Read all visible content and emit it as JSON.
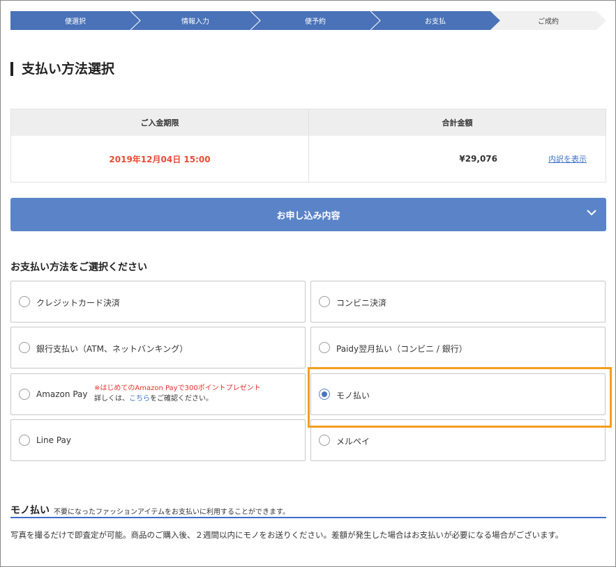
{
  "stepper": {
    "steps": [
      {
        "label": "便選択",
        "state": "done"
      },
      {
        "label": "情報入力",
        "state": "done"
      },
      {
        "label": "便予約",
        "state": "done"
      },
      {
        "label": "お支払",
        "state": "current"
      },
      {
        "label": "ご成約",
        "state": "todo"
      }
    ],
    "active_color": "#4a72b8",
    "todo_color": "#f0f0f0"
  },
  "page": {
    "title": "支払い方法選択"
  },
  "summary": {
    "deadline_header": "ご入金期限",
    "total_header": "合計金額",
    "deadline_value": "2019年12月04日 15:00",
    "total_value": "¥29,076",
    "breakdown_link": "内訳を表示"
  },
  "order_details": {
    "label": "お申し込み内容",
    "icon": "chevron-down-icon"
  },
  "payment": {
    "section_title": "お支払い方法をご選択ください",
    "options": [
      {
        "label": "クレジットカード決済",
        "selected": false
      },
      {
        "label": "コンビニ決済",
        "selected": false
      },
      {
        "label": "銀行支払い（ATM、ネットバンキング）",
        "selected": false
      },
      {
        "label": "Paidy翌月払い（コンビニ / 銀行）",
        "selected": false
      },
      {
        "label": "Amazon Pay",
        "selected": false
      },
      {
        "label": "モノ払い",
        "selected": true
      },
      {
        "label": "Line Pay",
        "selected": false
      },
      {
        "label": "メルペイ",
        "selected": false
      }
    ],
    "amazon_promo": {
      "campaign": "※はじめてのAmazon Payで300ポイントプレゼント",
      "details_prefix": "詳しくは、",
      "details_link": "こちら",
      "details_suffix": "をご確認ください。"
    },
    "highlight_color": "#f49e1e"
  },
  "mono_info": {
    "title": "モノ払い",
    "subtitle": "不要になったファッションアイテムをお支払いに利用することができます。",
    "description": "写真を撮るだけで即査定が可能。商品のご購入後、２週間以内にモノをお送りください。差額が発生した場合はお支払いが必要になる場合がございます。"
  }
}
